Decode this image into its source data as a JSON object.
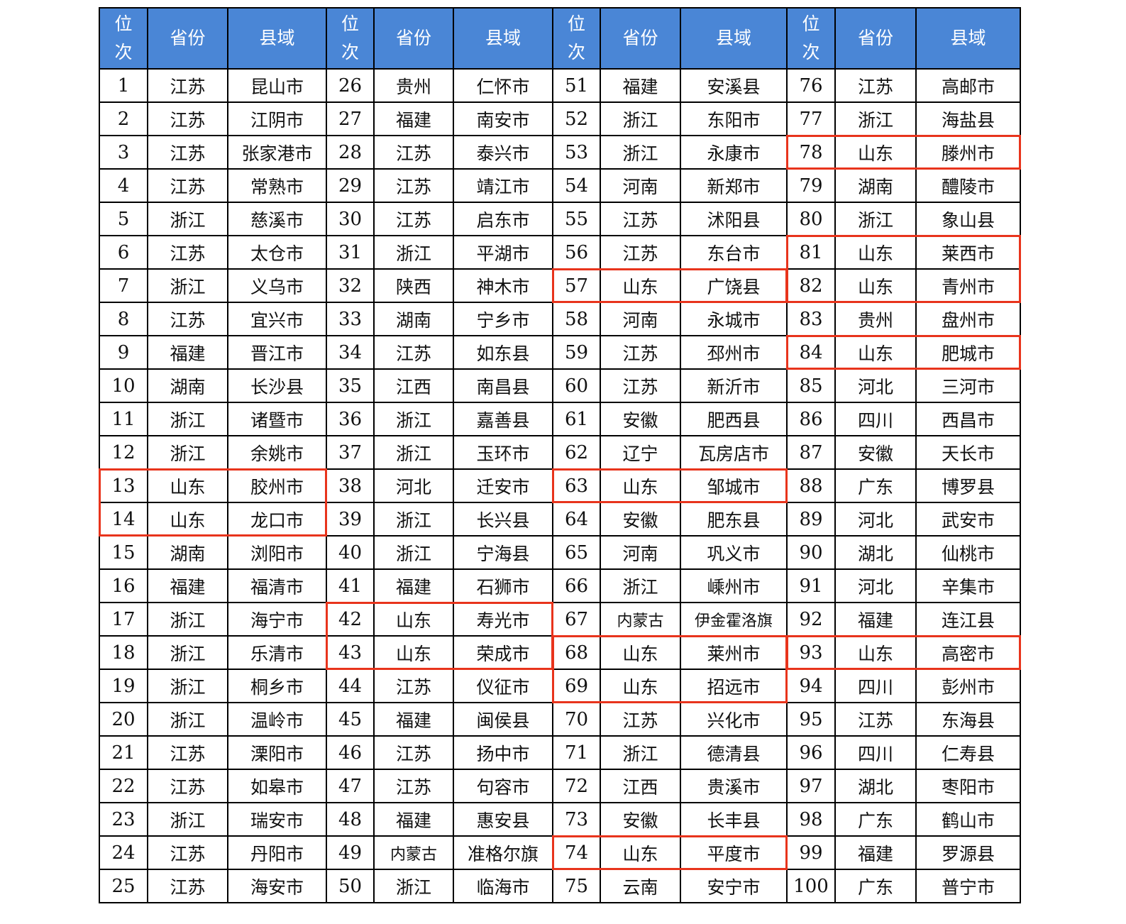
{
  "table": {
    "headers": {
      "rank_line1": "位",
      "rank_line2": "次",
      "province": "省份",
      "county": "县域"
    },
    "highlight_color": "#e8341c",
    "header_color": "#4a86d6",
    "highlighted_province": "山东",
    "groups": [
      [
        {
          "rank": "1",
          "province": "江苏",
          "county": "昆山市"
        },
        {
          "rank": "2",
          "province": "江苏",
          "county": "江阴市"
        },
        {
          "rank": "3",
          "province": "江苏",
          "county": "张家港市"
        },
        {
          "rank": "4",
          "province": "江苏",
          "county": "常熟市"
        },
        {
          "rank": "5",
          "province": "浙江",
          "county": "慈溪市"
        },
        {
          "rank": "6",
          "province": "江苏",
          "county": "太仓市"
        },
        {
          "rank": "7",
          "province": "浙江",
          "county": "义乌市"
        },
        {
          "rank": "8",
          "province": "江苏",
          "county": "宜兴市"
        },
        {
          "rank": "9",
          "province": "福建",
          "county": "晋江市"
        },
        {
          "rank": "10",
          "province": "湖南",
          "county": "长沙县"
        },
        {
          "rank": "11",
          "province": "浙江",
          "county": "诸暨市"
        },
        {
          "rank": "12",
          "province": "浙江",
          "county": "余姚市"
        },
        {
          "rank": "13",
          "province": "山东",
          "county": "胶州市"
        },
        {
          "rank": "14",
          "province": "山东",
          "county": "龙口市"
        },
        {
          "rank": "15",
          "province": "湖南",
          "county": "浏阳市"
        },
        {
          "rank": "16",
          "province": "福建",
          "county": "福清市"
        },
        {
          "rank": "17",
          "province": "浙江",
          "county": "海宁市"
        },
        {
          "rank": "18",
          "province": "浙江",
          "county": "乐清市"
        },
        {
          "rank": "19",
          "province": "浙江",
          "county": "桐乡市"
        },
        {
          "rank": "20",
          "province": "浙江",
          "county": "温岭市"
        },
        {
          "rank": "21",
          "province": "江苏",
          "county": "溧阳市"
        },
        {
          "rank": "22",
          "province": "江苏",
          "county": "如皋市"
        },
        {
          "rank": "23",
          "province": "浙江",
          "county": "瑞安市"
        },
        {
          "rank": "24",
          "province": "江苏",
          "county": "丹阳市"
        },
        {
          "rank": "25",
          "province": "江苏",
          "county": "海安市"
        }
      ],
      [
        {
          "rank": "26",
          "province": "贵州",
          "county": "仁怀市"
        },
        {
          "rank": "27",
          "province": "福建",
          "county": "南安市"
        },
        {
          "rank": "28",
          "province": "江苏",
          "county": "泰兴市"
        },
        {
          "rank": "29",
          "province": "江苏",
          "county": "靖江市"
        },
        {
          "rank": "30",
          "province": "江苏",
          "county": "启东市"
        },
        {
          "rank": "31",
          "province": "浙江",
          "county": "平湖市"
        },
        {
          "rank": "32",
          "province": "陕西",
          "county": "神木市"
        },
        {
          "rank": "33",
          "province": "湖南",
          "county": "宁乡市"
        },
        {
          "rank": "34",
          "province": "江苏",
          "county": "如东县"
        },
        {
          "rank": "35",
          "province": "江西",
          "county": "南昌县"
        },
        {
          "rank": "36",
          "province": "浙江",
          "county": "嘉善县"
        },
        {
          "rank": "37",
          "province": "浙江",
          "county": "玉环市"
        },
        {
          "rank": "38",
          "province": "河北",
          "county": "迁安市"
        },
        {
          "rank": "39",
          "province": "浙江",
          "county": "长兴县"
        },
        {
          "rank": "40",
          "province": "浙江",
          "county": "宁海县"
        },
        {
          "rank": "41",
          "province": "福建",
          "county": "石狮市"
        },
        {
          "rank": "42",
          "province": "山东",
          "county": "寿光市"
        },
        {
          "rank": "43",
          "province": "山东",
          "county": "荣成市"
        },
        {
          "rank": "44",
          "province": "江苏",
          "county": "仪征市"
        },
        {
          "rank": "45",
          "province": "福建",
          "county": "闽侯县"
        },
        {
          "rank": "46",
          "province": "江苏",
          "county": "扬中市"
        },
        {
          "rank": "47",
          "province": "江苏",
          "county": "句容市"
        },
        {
          "rank": "48",
          "province": "福建",
          "county": "惠安县"
        },
        {
          "rank": "49",
          "province": "内蒙古",
          "county": "准格尔旗"
        },
        {
          "rank": "50",
          "province": "浙江",
          "county": "临海市"
        }
      ],
      [
        {
          "rank": "51",
          "province": "福建",
          "county": "安溪县"
        },
        {
          "rank": "52",
          "province": "浙江",
          "county": "东阳市"
        },
        {
          "rank": "53",
          "province": "浙江",
          "county": "永康市"
        },
        {
          "rank": "54",
          "province": "河南",
          "county": "新郑市"
        },
        {
          "rank": "55",
          "province": "江苏",
          "county": "沭阳县"
        },
        {
          "rank": "56",
          "province": "江苏",
          "county": "东台市"
        },
        {
          "rank": "57",
          "province": "山东",
          "county": "广饶县"
        },
        {
          "rank": "58",
          "province": "河南",
          "county": "永城市"
        },
        {
          "rank": "59",
          "province": "江苏",
          "county": "邳州市"
        },
        {
          "rank": "60",
          "province": "江苏",
          "county": "新沂市"
        },
        {
          "rank": "61",
          "province": "安徽",
          "county": "肥西县"
        },
        {
          "rank": "62",
          "province": "辽宁",
          "county": "瓦房店市"
        },
        {
          "rank": "63",
          "province": "山东",
          "county": "邹城市"
        },
        {
          "rank": "64",
          "province": "安徽",
          "county": "肥东县"
        },
        {
          "rank": "65",
          "province": "河南",
          "county": "巩义市"
        },
        {
          "rank": "66",
          "province": "浙江",
          "county": "嵊州市"
        },
        {
          "rank": "67",
          "province": "内蒙古",
          "county": "伊金霍洛旗"
        },
        {
          "rank": "68",
          "province": "山东",
          "county": "莱州市"
        },
        {
          "rank": "69",
          "province": "山东",
          "county": "招远市"
        },
        {
          "rank": "70",
          "province": "江苏",
          "county": "兴化市"
        },
        {
          "rank": "71",
          "province": "浙江",
          "county": "德清县"
        },
        {
          "rank": "72",
          "province": "江西",
          "county": "贵溪市"
        },
        {
          "rank": "73",
          "province": "安徽",
          "county": "长丰县"
        },
        {
          "rank": "74",
          "province": "山东",
          "county": "平度市"
        },
        {
          "rank": "75",
          "province": "云南",
          "county": "安宁市"
        }
      ],
      [
        {
          "rank": "76",
          "province": "江苏",
          "county": "高邮市"
        },
        {
          "rank": "77",
          "province": "浙江",
          "county": "海盐县"
        },
        {
          "rank": "78",
          "province": "山东",
          "county": "滕州市"
        },
        {
          "rank": "79",
          "province": "湖南",
          "county": "醴陵市"
        },
        {
          "rank": "80",
          "province": "浙江",
          "county": "象山县"
        },
        {
          "rank": "81",
          "province": "山东",
          "county": "莱西市"
        },
        {
          "rank": "82",
          "province": "山东",
          "county": "青州市"
        },
        {
          "rank": "83",
          "province": "贵州",
          "county": "盘州市"
        },
        {
          "rank": "84",
          "province": "山东",
          "county": "肥城市"
        },
        {
          "rank": "85",
          "province": "河北",
          "county": "三河市"
        },
        {
          "rank": "86",
          "province": "四川",
          "county": "西昌市"
        },
        {
          "rank": "87",
          "province": "安徽",
          "county": "天长市"
        },
        {
          "rank": "88",
          "province": "广东",
          "county": "博罗县"
        },
        {
          "rank": "89",
          "province": "河北",
          "county": "武安市"
        },
        {
          "rank": "90",
          "province": "湖北",
          "county": "仙桃市"
        },
        {
          "rank": "91",
          "province": "河北",
          "county": "辛集市"
        },
        {
          "rank": "92",
          "province": "福建",
          "county": "连江县"
        },
        {
          "rank": "93",
          "province": "山东",
          "county": "高密市"
        },
        {
          "rank": "94",
          "province": "四川",
          "county": "彭州市"
        },
        {
          "rank": "95",
          "province": "江苏",
          "county": "东海县"
        },
        {
          "rank": "96",
          "province": "四川",
          "county": "仁寿县"
        },
        {
          "rank": "97",
          "province": "湖北",
          "county": "枣阳市"
        },
        {
          "rank": "98",
          "province": "广东",
          "county": "鹤山市"
        },
        {
          "rank": "99",
          "province": "福建",
          "county": "罗源县"
        },
        {
          "rank": "100",
          "province": "广东",
          "county": "普宁市"
        }
      ]
    ]
  }
}
